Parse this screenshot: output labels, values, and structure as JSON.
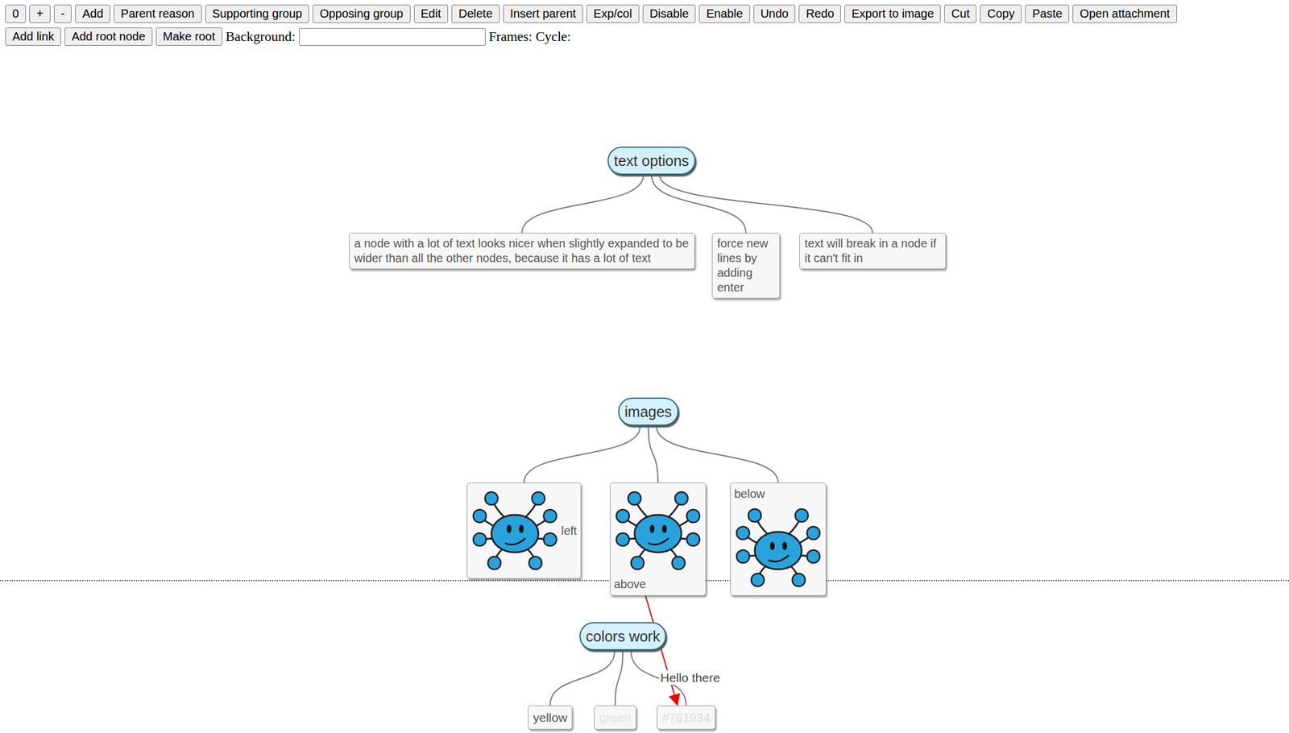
{
  "toolbar": {
    "row1": [
      "0",
      "+",
      "-",
      "Add",
      "Parent reason",
      "Supporting group",
      "Opposing group",
      "Edit",
      "Delete",
      "Insert parent",
      "Exp/col",
      "Disable",
      "Enable",
      "Undo",
      "Redo",
      "Export to image",
      "Cut",
      "Copy",
      "Paste",
      "Open attachment"
    ],
    "row2": [
      "Add link",
      "Add root node",
      "Make root"
    ]
  },
  "background": {
    "label": "Background:",
    "value": ""
  },
  "frames": "Frames: Cycle:",
  "map": {
    "text_options": {
      "title": "text options",
      "children": [
        "a node with a lot of text looks nicer when slightly expanded to be wider than all the other nodes, because it has a lot of text",
        "force new lines by adding enter",
        "text will break in a node if it can't fit in"
      ]
    },
    "images": {
      "title": "images",
      "children": [
        {
          "kind": "left",
          "label": "left"
        },
        {
          "kind": "above",
          "label": "above"
        },
        {
          "kind": "below",
          "label": "below"
        }
      ]
    },
    "colors_work": {
      "title": "colors work",
      "children": [
        {
          "label": "yellow",
          "color": "#555555"
        },
        {
          "label": "green",
          "color": "#dfe8df"
        },
        {
          "label": "#761934",
          "color": "#e2dadc"
        }
      ]
    },
    "link": {
      "label": "Hello there"
    }
  }
}
